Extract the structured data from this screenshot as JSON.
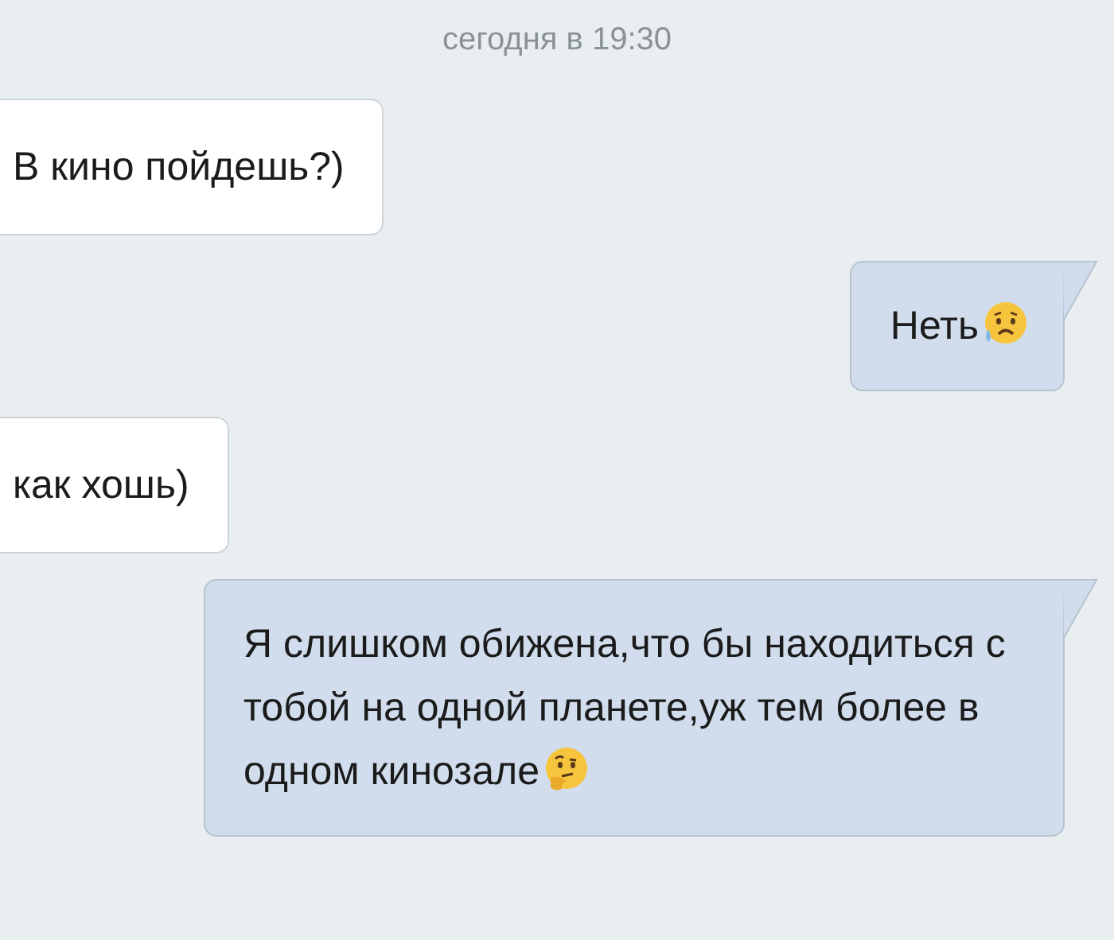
{
  "date_header": "сегодня в 19:30",
  "messages": [
    {
      "kind": "incoming",
      "text": "В кино пойдешь?)"
    },
    {
      "kind": "outgoing",
      "text": "Неть",
      "trailing_emoji": {
        "kind": "sad-face"
      }
    },
    {
      "kind": "incoming",
      "text": "как хошь)"
    },
    {
      "kind": "outgoing",
      "text": "Я слишком обижена,что бы находиться с тобой на одной планете,уж тем более в одном кинозале",
      "trailing_emoji": {
        "kind": "thinking-face"
      }
    }
  ]
}
